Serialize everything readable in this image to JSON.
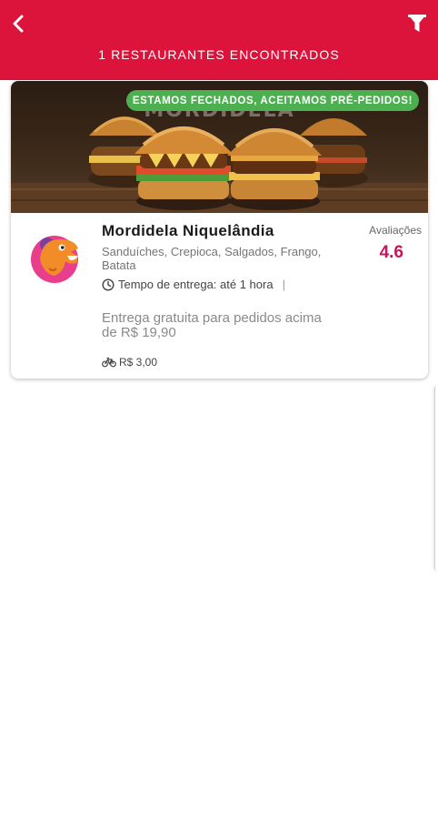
{
  "header": {
    "title": "1 RESTAURANTES ENCONTRADOS",
    "back_icon": "chevron-left-icon",
    "filter_icon": "filter-funnel-icon",
    "background": "#dc143c"
  },
  "restaurants": [
    {
      "banner_watermark": "MORDIDELA",
      "status_badge": "ESTAMOS FECHADOS, ACEITAMOS PRÉ-PEDIDOS!",
      "status_color": "#4caf50",
      "name": "Mordidela Niquelândia",
      "categories": "Sanduíches, Crepioca, Salgados, Frango, Batata",
      "delivery_time": "Tempo de entrega: até 1 hora",
      "free_delivery": "Entrega gratuita para pedidos acima de R$ 19,90",
      "delivery_fee": "R$ 3,00",
      "ratings_label": "Avaliações",
      "rating": "4.6",
      "rating_color": "#c2185b"
    }
  ]
}
